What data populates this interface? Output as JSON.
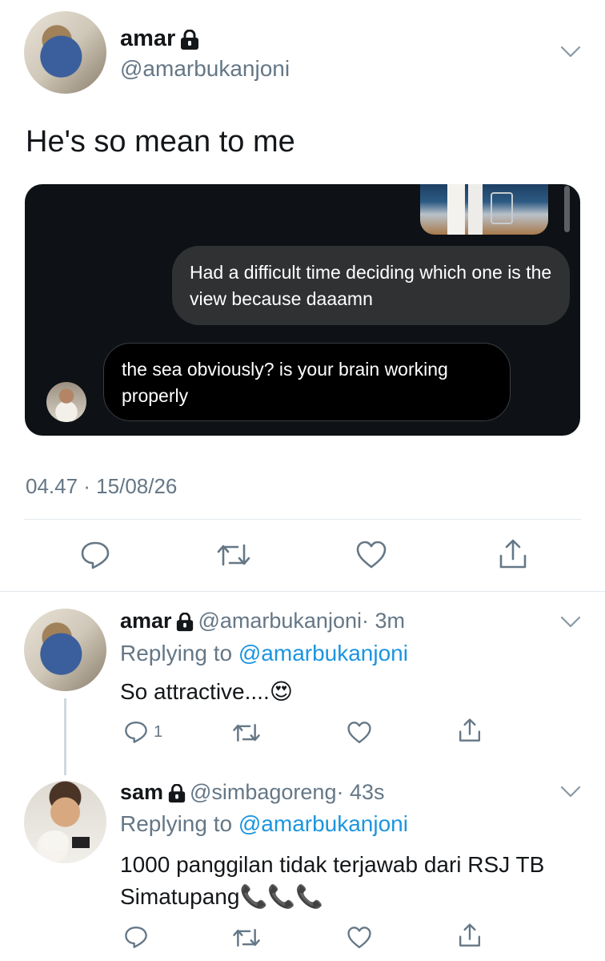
{
  "tweet": {
    "name": "amar",
    "handle": "@amarbukanjoni",
    "text": "He's so mean to me",
    "timestamp": "04.47 · 15/08/26",
    "dm_card": {
      "message_sent": "Had a difficult time deciding which one is the view because daaamn",
      "message_received": "the sea obviously? is your brain working properly"
    },
    "actions": [
      "reply-icon",
      "retweet-icon",
      "like-icon",
      "share-icon"
    ]
  },
  "replies": [
    {
      "name": "amar",
      "handle": "@amarbukanjoni",
      "time": "· 3m",
      "replying_prefix": "Replying to",
      "replying_to": "@amarbukanjoni",
      "text": "So attractive....",
      "emoji": "😍",
      "reply_count": "1"
    },
    {
      "name": "sam",
      "handle": "@simbagoreng",
      "time": "· 43s",
      "replying_prefix": "Replying to",
      "replying_to": "@amarbukanjoni",
      "text": "1000 panggilan tidak terjawab dari RSJ TB Simatupang",
      "emoji": "📞📞📞",
      "reply_count": ""
    }
  ],
  "colors": {
    "link": "#1b95e0",
    "muted": "#657786",
    "card_bg": "#0e1115"
  }
}
